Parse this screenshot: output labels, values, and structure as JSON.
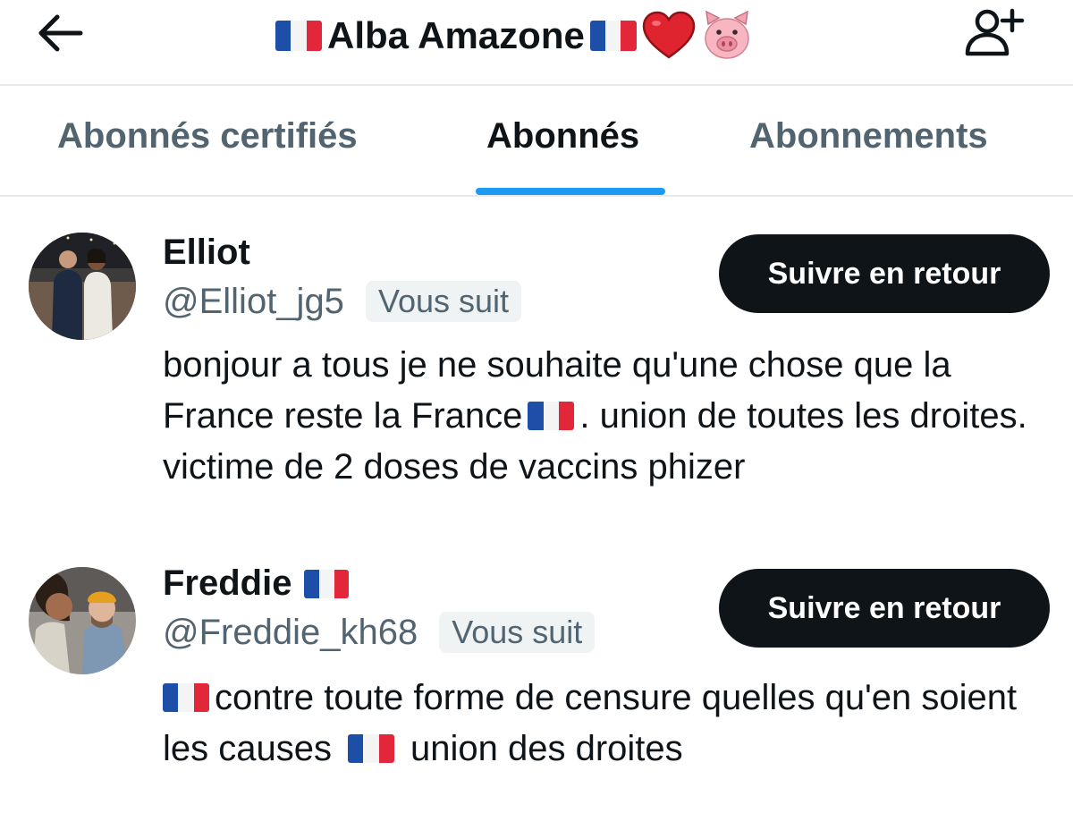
{
  "header": {
    "title": "Alba Amazone",
    "back_icon": "arrow-left-icon",
    "add_user_icon": "person-plus-icon"
  },
  "tabs": [
    {
      "label": "Abonnés certifiés",
      "active": false
    },
    {
      "label": "Abonnés",
      "active": true
    },
    {
      "label": "Abonnements",
      "active": false
    }
  ],
  "colors": {
    "accent": "#1d9bf0",
    "button_bg": "#0f1419",
    "secondary_text": "#536471"
  },
  "users": [
    {
      "name": "Elliot",
      "handle": "@Elliot_jg5",
      "follows_you": "Vous suit",
      "button": "Suivre en retour",
      "bio": {
        "part1": "bonjour a tous je ne souhaite qu'une chose que la France reste la France",
        "part2": ". union de toutes les droites. victime de 2 doses de vaccins phizer"
      }
    },
    {
      "name": "Freddie",
      "handle": "@Freddie_kh68",
      "follows_you": "Vous suit",
      "button": "Suivre en retour",
      "bio": {
        "part1": "contre toute forme de censure quelles qu'en soient les causes",
        "part2": "union des droites"
      }
    }
  ]
}
